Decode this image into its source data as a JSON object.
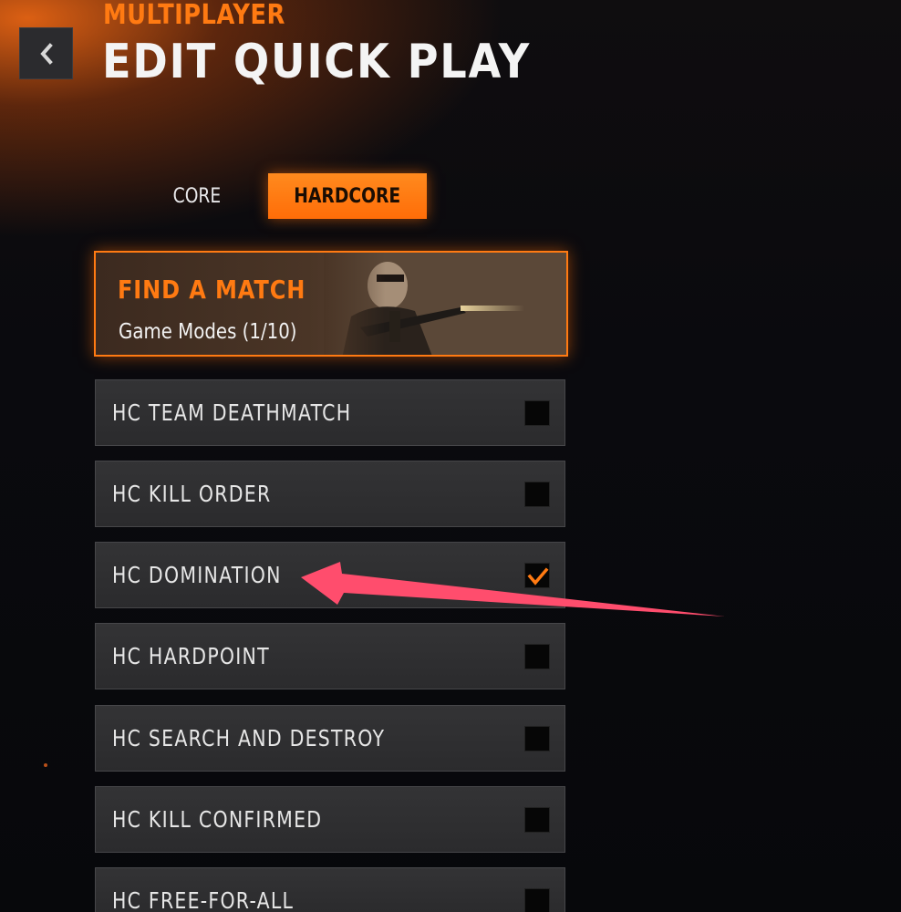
{
  "header": {
    "section": "MULTIPLAYER",
    "title": "EDIT QUICK PLAY"
  },
  "tabs": [
    {
      "label": "CORE",
      "selected": false
    },
    {
      "label": "HARDCORE",
      "selected": true
    }
  ],
  "find_match": {
    "title": "FIND A MATCH",
    "subtitle": "Game Modes (1/10)"
  },
  "modes": [
    {
      "label": "HC TEAM DEATHMATCH",
      "checked": false
    },
    {
      "label": "HC KILL ORDER",
      "checked": false
    },
    {
      "label": "HC DOMINATION",
      "checked": true
    },
    {
      "label": "HC HARDPOINT",
      "checked": false
    },
    {
      "label": "HC SEARCH AND DESTROY",
      "checked": false
    },
    {
      "label": "HC KILL CONFIRMED",
      "checked": false
    },
    {
      "label": "HC FREE-FOR-ALL",
      "checked": false
    }
  ],
  "colors": {
    "accent": "#ff7a12",
    "annotation_arrow": "#ff4d6d"
  }
}
